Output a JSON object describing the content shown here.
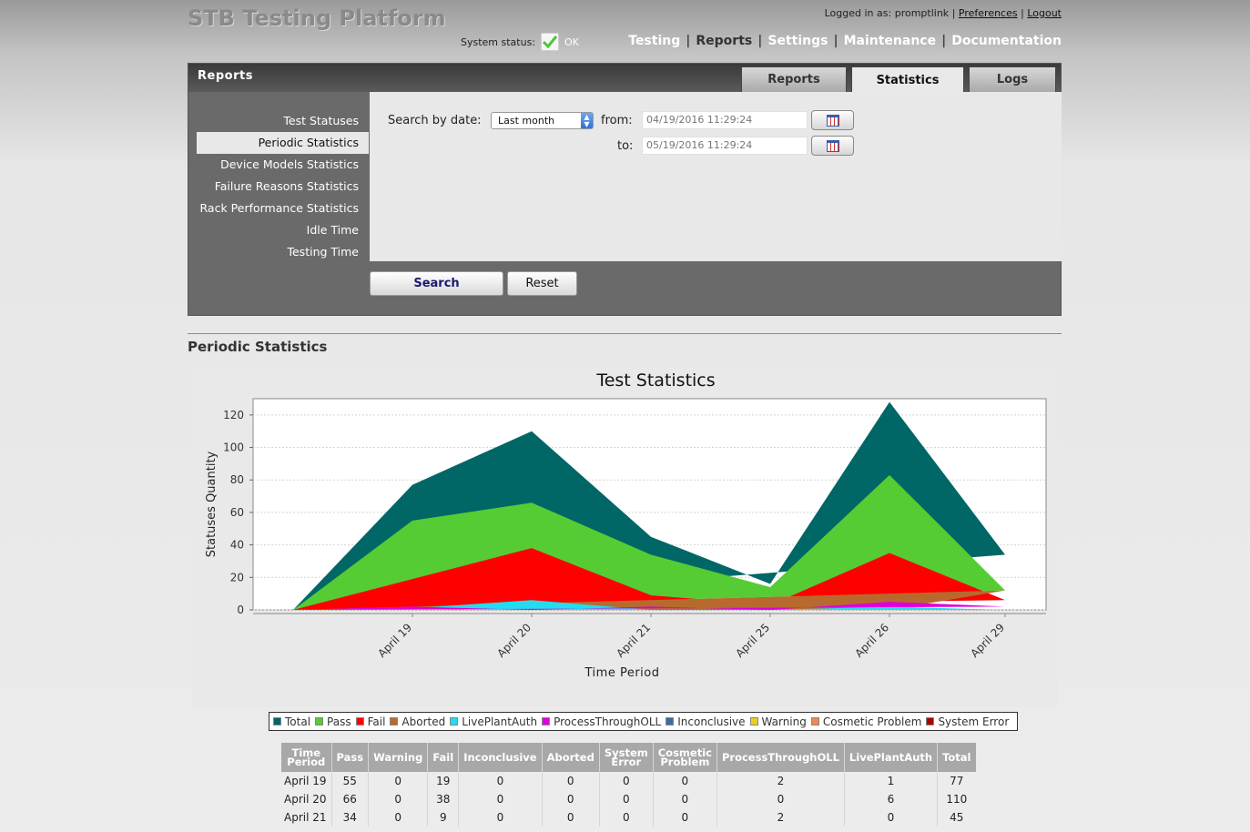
{
  "app": {
    "title": "STB Testing Platform",
    "logged_in_label": "Logged in as:",
    "username": "promptlink",
    "preferences_link": "Preferences",
    "logout_link": "Logout",
    "separator": "|",
    "system_status_label": "System status:",
    "system_status_value": "OK",
    "status_icon": "check-icon",
    "status_color": "#4cc63a"
  },
  "main_nav": [
    {
      "label": "Testing",
      "active": false
    },
    {
      "label": "Reports",
      "active": true
    },
    {
      "label": "Settings",
      "active": false
    },
    {
      "label": "Maintenance",
      "active": false
    },
    {
      "label": "Documentation",
      "active": false
    }
  ],
  "panel": {
    "title": "Reports",
    "tabs": [
      {
        "label": "Reports",
        "active": false
      },
      {
        "label": "Statistics",
        "active": true
      },
      {
        "label": "Logs",
        "active": false
      }
    ],
    "side_menu": [
      {
        "label": "Test Statuses",
        "active": false
      },
      {
        "label": "Periodic Statistics",
        "active": true
      },
      {
        "label": "Device Models Statistics",
        "active": false
      },
      {
        "label": "Failure Reasons Statistics",
        "active": false
      },
      {
        "label": "Rack Performance Statistics",
        "active": false
      },
      {
        "label": "Idle Time",
        "active": false
      },
      {
        "label": "Testing Time",
        "active": false
      }
    ],
    "search": {
      "by_date_label": "Search by date:",
      "date_range_selected": "Last month",
      "from_label": "from:",
      "from_value": "04/19/2016 11:29:24",
      "to_label": "to:",
      "to_value": "05/19/2016 11:29:24",
      "calendar_icon": "calendar-icon",
      "search_button": "Search",
      "reset_button": "Reset"
    }
  },
  "section_title": "Periodic Statistics",
  "chart_data": {
    "type": "area",
    "title": "Test Statistics",
    "xlabel": "Time Period",
    "ylabel": "Statuses Quantity",
    "categories": [
      "April 19",
      "April 20",
      "April 21",
      "April 25",
      "April 26",
      "April 29"
    ],
    "ylim": [
      0,
      130
    ],
    "yticks": [
      0,
      20,
      40,
      60,
      80,
      100,
      120
    ],
    "grid": true,
    "legend_position": "bottom",
    "series": [
      {
        "name": "Total",
        "color": "#006666",
        "values": [
          77,
          110,
          45,
          16,
          128,
          34
        ]
      },
      {
        "name": "Pass",
        "color": "#55cc33",
        "values": [
          55,
          66,
          34,
          14,
          83,
          12
        ]
      },
      {
        "name": "Fail",
        "color": "#ff0000",
        "values": [
          19,
          38,
          9,
          3,
          35,
          6
        ]
      },
      {
        "name": "Aborted",
        "color": "#b86a2e",
        "values": [
          0,
          0,
          0,
          0,
          0,
          12
        ]
      },
      {
        "name": "LivePlantAuth",
        "color": "#22ddee",
        "values": [
          1,
          6,
          0,
          0,
          2,
          0
        ]
      },
      {
        "name": "ProcessThroughOLL",
        "color": "#dd00dd",
        "values": [
          2,
          0,
          2,
          0,
          5,
          2
        ]
      },
      {
        "name": "Inconclusive",
        "color": "#3a6aa8",
        "values": [
          0,
          0,
          0,
          0,
          0,
          0
        ]
      },
      {
        "name": "Warning",
        "color": "#e8d020",
        "values": [
          0,
          0,
          0,
          0,
          0,
          0
        ]
      },
      {
        "name": "Cosmetic Problem",
        "color": "#ee8855",
        "values": [
          0,
          0,
          0,
          0,
          0,
          0
        ]
      },
      {
        "name": "System Error",
        "color": "#aa0000",
        "values": [
          0,
          0,
          0,
          0,
          0,
          0
        ]
      }
    ]
  },
  "table": {
    "headers": [
      "Time\nPeriod",
      "Pass",
      "Warning",
      "Fail",
      "Inconclusive",
      "Aborted",
      "System\nError",
      "Cosmetic\nProblem",
      "ProcessThroughOLL",
      "LivePlantAuth",
      "Total"
    ],
    "rows": [
      [
        "April 19",
        "55",
        "0",
        "19",
        "0",
        "0",
        "0",
        "0",
        "2",
        "1",
        "77"
      ],
      [
        "April 20",
        "66",
        "0",
        "38",
        "0",
        "0",
        "0",
        "0",
        "0",
        "6",
        "110"
      ],
      [
        "April 21",
        "34",
        "0",
        "9",
        "0",
        "0",
        "0",
        "0",
        "2",
        "0",
        "45"
      ]
    ]
  }
}
